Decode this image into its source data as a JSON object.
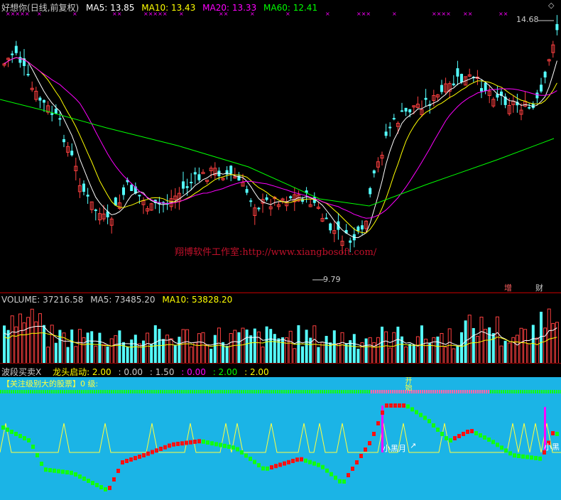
{
  "colors": {
    "bg": "#000000",
    "grid": "#8b0000",
    "up": "#ff4040",
    "down": "#54ffff",
    "ma5": "#ffffff",
    "ma10": "#ffff00",
    "ma20": "#ff00ff",
    "ma60": "#00ff00",
    "ind_bg": "#1bb4e6",
    "ind_red": "#ff1010",
    "ind_green": "#10ff10",
    "ind_yellow": "#ffff40",
    "ind_magenta": "#ff00ff",
    "ind_pink": "#ff66aa"
  },
  "price_pane": {
    "stock_name": "好想你",
    "period": "(日线,前复权)",
    "ma5": "MA5: 13.85",
    "ma10": "MA10: 13.43",
    "ma20": "MA20: 13.33",
    "ma60": "MA60: 12.41",
    "high_label": "14.68",
    "low_label": "9.79",
    "watermark": "翔博软件工作室:http://www.xiangbosoft.com/",
    "badge_increase": "增",
    "badge_finance": "财",
    "marker_rows": [
      "×××××",
      "×",
      "×",
      "××",
      "×××××",
      "×",
      "××",
      "×",
      "×",
      "×",
      "×××",
      "×",
      "××××",
      "××",
      "××"
    ]
  },
  "volume_pane": {
    "volume": "VOLUME: 37216.58",
    "ma5": "MA5: 73485.20",
    "ma10": "MA10: 53828.20"
  },
  "indicator_pane": {
    "name": "波段买卖X",
    "signal_label": "龙头启动: 2.00",
    "val1": ": 0.00",
    "val2": ": 1.50",
    "val3": ": 0.00",
    "val4": ": 2.00",
    "val5": ": 2.00",
    "banner": "【关注级别大的股票】0 级:",
    "label_xiaohei1": "小黑月",
    "label_xiaohei2": "小黑",
    "label_kaipao": "开始",
    "label_kaipao2": "超",
    "arrow": "↗"
  }
}
